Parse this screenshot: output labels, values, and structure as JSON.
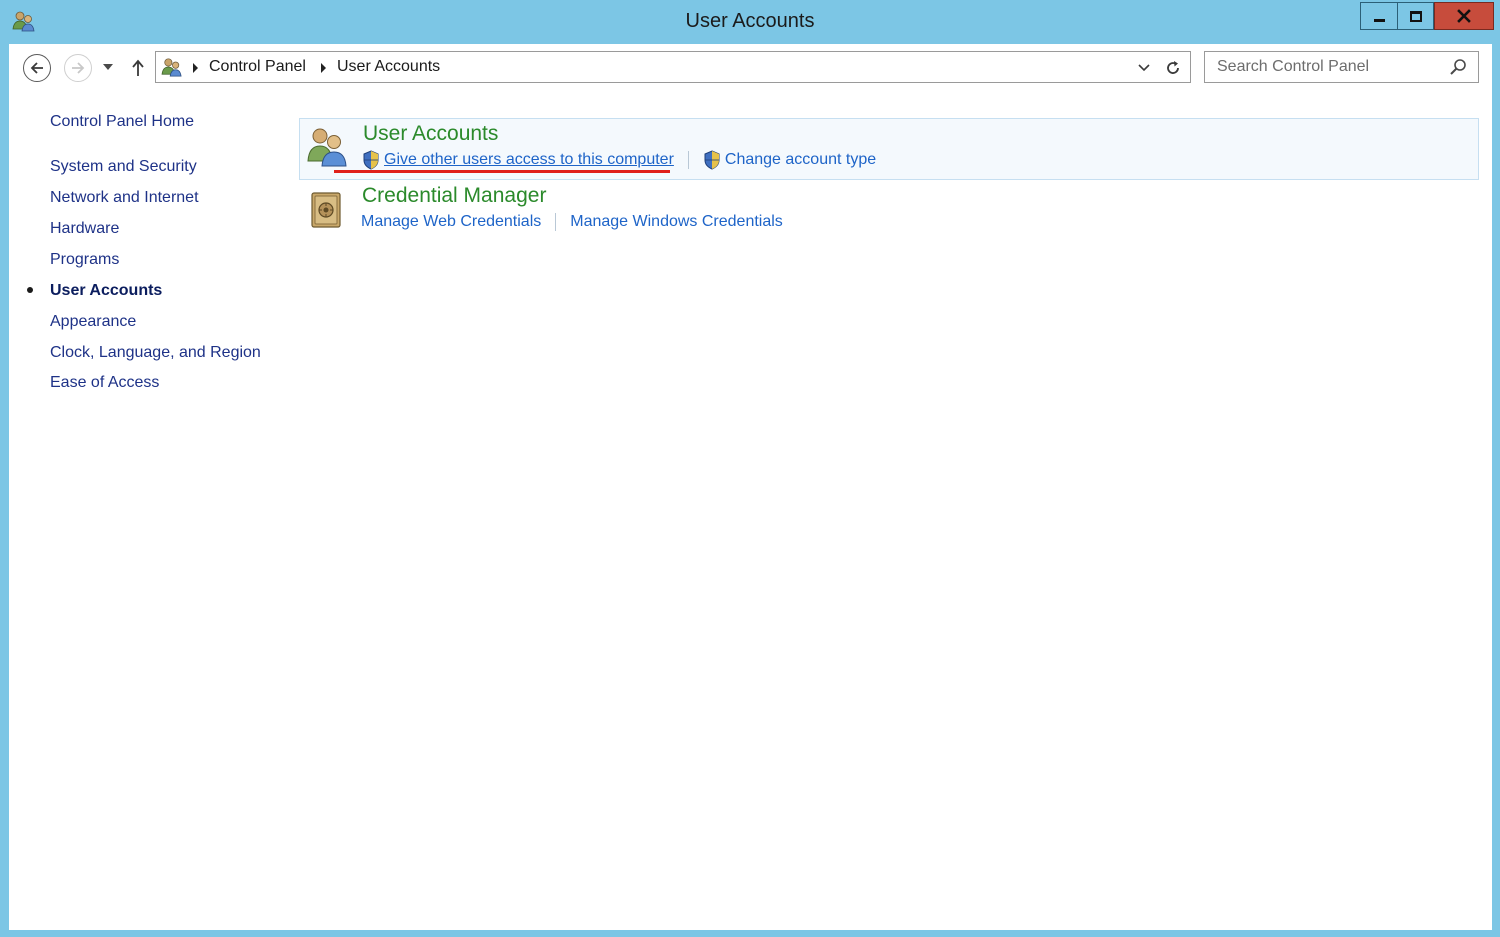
{
  "window": {
    "title": "User Accounts",
    "title_icon": "user-accounts-icon"
  },
  "nav": {
    "back_icon": "back-arrow-icon",
    "forward_icon": "forward-arrow-icon",
    "recent_icon": "chevron-down-icon",
    "up_icon": "up-arrow-icon"
  },
  "address": {
    "crumbs": [
      "Control Panel",
      "User Accounts"
    ],
    "refresh_icon": "refresh-icon"
  },
  "search": {
    "placeholder": "Search Control Panel"
  },
  "sidebar": {
    "home": "Control Panel Home",
    "items": [
      {
        "label": "System and Security",
        "active": false
      },
      {
        "label": "Network and Internet",
        "active": false
      },
      {
        "label": "Hardware",
        "active": false
      },
      {
        "label": "Programs",
        "active": false
      },
      {
        "label": "User Accounts",
        "active": true
      },
      {
        "label": "Appearance",
        "active": false
      },
      {
        "label": "Clock, Language, and Region",
        "active": false
      },
      {
        "label": "Ease of Access",
        "active": false
      }
    ]
  },
  "main": {
    "categories": [
      {
        "title": "User Accounts",
        "icon": "users-icon",
        "tasks": [
          {
            "label": "Give other users access to this computer",
            "shield": true,
            "underlined": true
          },
          {
            "label": "Change account type",
            "shield": true,
            "underlined": false
          }
        ]
      },
      {
        "title": "Credential Manager",
        "icon": "vault-icon",
        "tasks": [
          {
            "label": "Manage Web Credentials",
            "shield": false
          },
          {
            "label": "Manage Windows Credentials",
            "shield": false
          }
        ]
      }
    ]
  },
  "colors": {
    "frame": "#7cc6e5",
    "close": "#c74c3c",
    "category_title": "#2b8a2b",
    "task_link": "#1e64c8",
    "sidebar_link": "#1e3287",
    "annotation": "#e0201a"
  }
}
